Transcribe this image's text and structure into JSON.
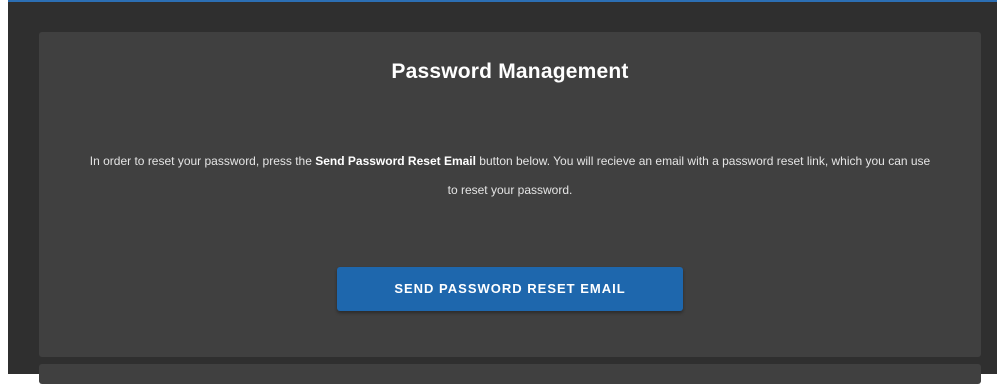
{
  "colors": {
    "frame_background": "#2f2f2f",
    "panel_background": "#404040",
    "accent": "#1e67ad",
    "top_border": "#2c6fb4"
  },
  "panel": {
    "title": "Password Management",
    "description": {
      "before": "In order to reset your password, press the ",
      "emphasis": "Send Password Reset Email",
      "after": " button below. You will recieve an email with a password reset link, which you can use to reset your password."
    },
    "button_label": "SEND PASSWORD RESET EMAIL"
  }
}
